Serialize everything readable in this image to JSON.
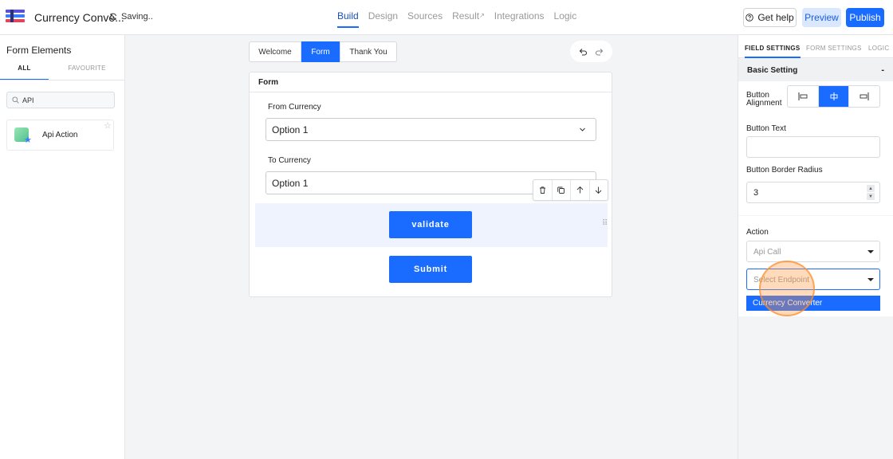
{
  "topbar": {
    "app_title": "Currency Conve...",
    "status": "Saving..",
    "nav": [
      "Build",
      "Design",
      "Sources",
      "Result",
      "Integrations",
      "Logic"
    ],
    "help_label": "Get help",
    "preview_label": "Preview",
    "publish_label": "Publish"
  },
  "left_panel": {
    "title": "Form Elements",
    "tabs": [
      "ALL",
      "FAVOURITE"
    ],
    "search_value": "API",
    "elements": [
      {
        "label": "Api Action"
      }
    ]
  },
  "canvas": {
    "pages": [
      "Welcome",
      "Form",
      "Thank You"
    ],
    "form_title": "Form",
    "fields": [
      {
        "label": "From Currency",
        "value": "Option 1"
      },
      {
        "label": "To Currency",
        "value": "Option 1"
      }
    ],
    "validate_label": "validate",
    "submit_label": "Submit"
  },
  "right_panel": {
    "tabs": [
      "FIELD SETTINGS",
      "FORM SETTINGS",
      "LOGIC"
    ],
    "section_title": "Basic Setting",
    "collapse_symbol": "-",
    "button_alignment_label": "Button\nAlignment",
    "button_text_label": "Button Text",
    "button_text_value": "",
    "border_radius_label": "Button Border Radius",
    "border_radius_value": "3",
    "action_label": "Action",
    "action_value": "Api Call",
    "endpoint_placeholder": "Select Endpoint",
    "endpoint_option": "Currency Converter"
  },
  "colors": {
    "accent": "#1a6bff",
    "preview_bg": "#d9e7ff"
  }
}
